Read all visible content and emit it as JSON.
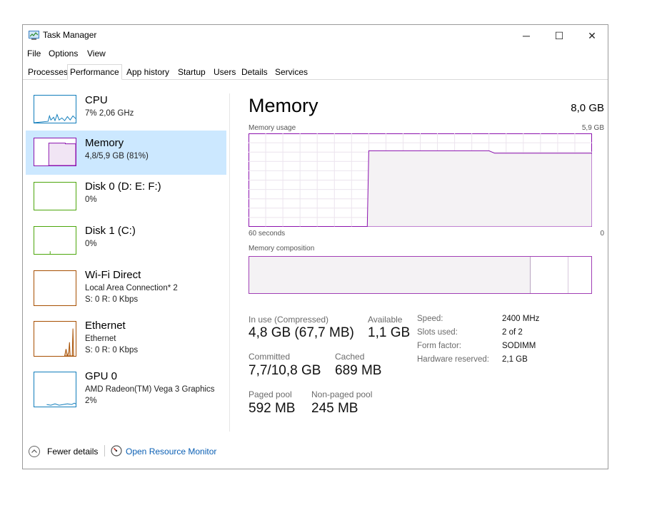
{
  "window": {
    "title": "Task Manager",
    "controls": {
      "minimize": "─",
      "maximize": "☐",
      "close": "✕"
    }
  },
  "menu": [
    "File",
    "Options",
    "View"
  ],
  "tabs": [
    "Processes",
    "Performance",
    "App history",
    "Startup",
    "Users",
    "Details",
    "Services"
  ],
  "active_tab": "Performance",
  "sidebar": {
    "items": [
      {
        "title": "CPU",
        "lines": [
          "7% 2,06 GHz"
        ],
        "color": "#117dbb",
        "selected": false
      },
      {
        "title": "Memory",
        "lines": [
          "4,8/5,9 GB (81%)"
        ],
        "color": "#8b12ae",
        "selected": true
      },
      {
        "title": "Disk 0 (D: E: F:)",
        "lines": [
          "0%"
        ],
        "color": "#4da60c",
        "selected": false
      },
      {
        "title": "Disk 1 (C:)",
        "lines": [
          "0%"
        ],
        "color": "#4da60c",
        "selected": false
      },
      {
        "title": "Wi-Fi Direct",
        "lines": [
          "Local Area Connection* 2",
          "S: 0 R: 0 Kbps"
        ],
        "color": "#a74f01",
        "selected": false
      },
      {
        "title": "Ethernet",
        "lines": [
          "Ethernet",
          "S: 0 R: 0 Kbps"
        ],
        "color": "#a74f01",
        "selected": false
      },
      {
        "title": "GPU 0",
        "lines": [
          "AMD Radeon(TM) Vega 3 Graphics",
          "2%"
        ],
        "color": "#117dbb",
        "selected": false
      }
    ]
  },
  "main": {
    "title": "Memory",
    "total": "8,0 GB",
    "usage_label": "Memory usage",
    "usage_max": "5,9 GB",
    "time_left": "60 seconds",
    "time_right": "0",
    "composition_label": "Memory composition",
    "stats": {
      "in_use_label": "In use (Compressed)",
      "in_use_value": "4,8 GB (67,7 MB)",
      "available_label": "Available",
      "available_value": "1,1 GB",
      "committed_label": "Committed",
      "committed_value": "7,7/10,8 GB",
      "cached_label": "Cached",
      "cached_value": "689 MB",
      "paged_label": "Paged pool",
      "paged_value": "592 MB",
      "nonpaged_label": "Non-paged pool",
      "nonpaged_value": "245 MB"
    },
    "specs": [
      {
        "label": "Speed:",
        "value": "2400 MHz"
      },
      {
        "label": "Slots used:",
        "value": "2 of 2"
      },
      {
        "label": "Form factor:",
        "value": "SODIMM"
      },
      {
        "label": "Hardware reserved:",
        "value": "2,1 GB"
      }
    ]
  },
  "chart_data": {
    "type": "area",
    "series": [
      {
        "values": [
          0,
          0,
          0,
          0,
          0,
          0,
          0,
          0,
          0,
          0,
          0,
          0,
          0,
          0,
          0,
          0,
          0,
          0,
          0,
          0,
          0,
          4.8,
          4.8,
          4.8,
          4.8,
          4.8,
          4.8,
          4.8,
          4.8,
          4.8,
          4.8,
          4.8,
          4.8,
          4.8,
          4.8,
          4.8,
          4.8,
          4.8,
          4.8,
          4.8,
          4.8,
          4.8,
          4.8,
          4.65,
          4.65,
          4.65,
          4.65,
          4.65,
          4.65,
          4.65,
          4.65,
          4.65,
          4.65,
          4.65,
          4.65,
          4.65,
          4.65,
          4.65,
          4.65,
          4.65,
          4.65
        ]
      }
    ],
    "ylim": [
      0,
      5.9
    ],
    "color": "#8b12ae",
    "fill": "#f4f2f4"
  },
  "footer": {
    "fewer_details": "Fewer details",
    "resource_monitor": "Open Resource Monitor"
  }
}
